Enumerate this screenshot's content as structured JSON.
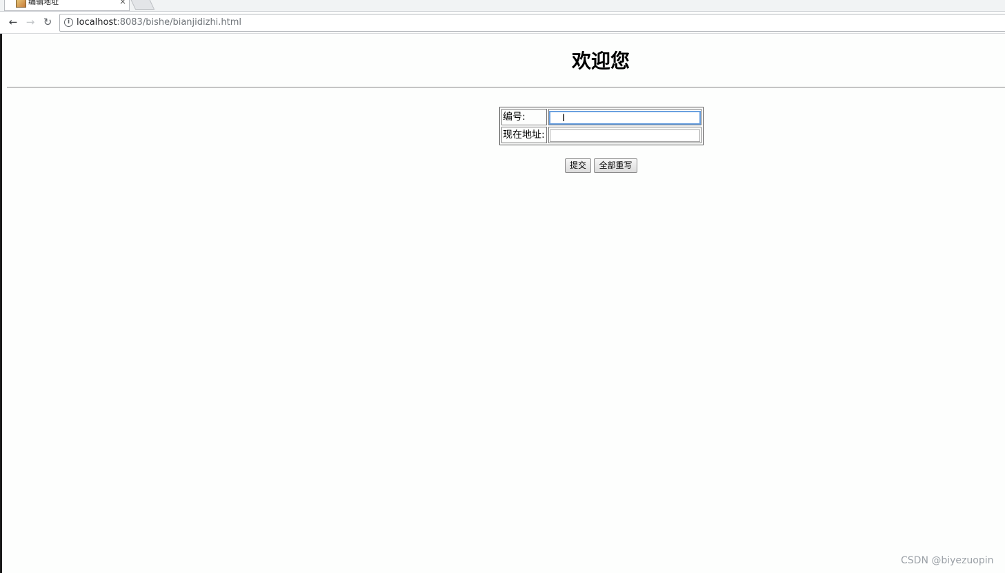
{
  "browser": {
    "tab_title": "编辑地址",
    "tab_close": "×",
    "url_host": "localhost",
    "url_rest": ":8083/bishe/bianjidizhi.html",
    "nav": {
      "back": "←",
      "forward": "→",
      "reload": "↻",
      "info": "i"
    }
  },
  "page": {
    "heading": "欢迎您",
    "form": {
      "fields": [
        {
          "label": "编号:",
          "value": "",
          "focused": true
        },
        {
          "label": "现在地址:",
          "value": ""
        }
      ],
      "submit_label": "提交",
      "reset_label": "全部重写"
    },
    "caret": "I"
  },
  "watermark": "CSDN @biyezuopin",
  "colors": {
    "background": "#fdfefd",
    "focus_outline": "#6aa0e0",
    "watermark": "#9aa0a6"
  }
}
